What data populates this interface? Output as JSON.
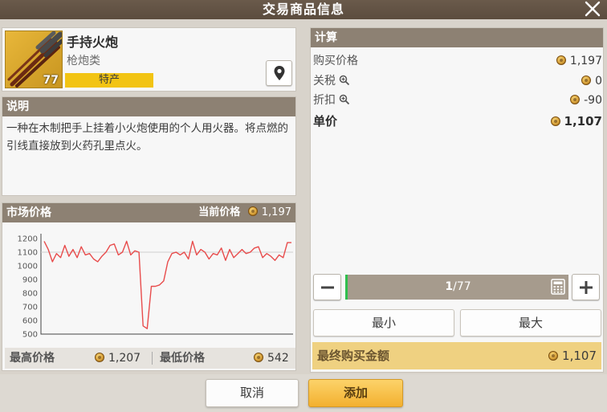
{
  "window": {
    "title": "交易商品信息"
  },
  "item": {
    "name": "手持火炮",
    "category": "枪炮类",
    "badge": "特产",
    "count": "77"
  },
  "description": {
    "header": "说明",
    "text": "一种在木制把手上挂着小火炮使用的个人用火器。将点燃的引线直接放到火药孔里点火。"
  },
  "market": {
    "header": "市场价格",
    "current_label": "当前价格",
    "current_value": "1,197",
    "high_label": "最高价格",
    "high_value": "1,207",
    "low_label": "最低价格",
    "low_value": "542"
  },
  "calc": {
    "header": "计算",
    "rows": [
      {
        "label": "购买价格",
        "value": "1,197"
      },
      {
        "label": "关税",
        "value": "0"
      },
      {
        "label": "折扣",
        "value": "-90"
      },
      {
        "label": "单价",
        "value": "1,107"
      }
    ],
    "quantity_current": "1",
    "quantity_max": "/77",
    "min_label": "最小",
    "max_label": "最大",
    "final_label": "最终购买金额",
    "final_value": "1,107"
  },
  "footer": {
    "cancel_label": "取消",
    "add_label": "添加"
  },
  "chart_data": {
    "type": "line",
    "title": "",
    "xlabel": "",
    "ylabel": "",
    "ylim": [
      500,
      1200
    ],
    "yticks": [
      1200,
      1100,
      1000,
      900,
      800,
      700,
      600,
      500
    ],
    "grid": false,
    "reference_line": 1100,
    "series": [
      {
        "values": [
          1180,
          1120,
          1030,
          1090,
          1060,
          1150,
          1070,
          1120,
          1060,
          1140,
          1080,
          1090,
          1050,
          1030,
          1070,
          1100,
          1150,
          1160,
          1080,
          1100,
          1180,
          1080,
          1110,
          1100,
          560,
          540,
          850,
          850,
          860,
          890,
          1030,
          1090,
          1100,
          1080,
          1100,
          1050,
          1180,
          1080,
          1120,
          1100,
          1050,
          1090,
          1080,
          1130,
          1040,
          1120,
          1060,
          1090,
          1120,
          1090,
          1100,
          1130,
          1140,
          1060,
          1090,
          1070,
          1040,
          1080,
          1060,
          1170,
          1170
        ]
      }
    ],
    "color": "#e84c4c"
  }
}
